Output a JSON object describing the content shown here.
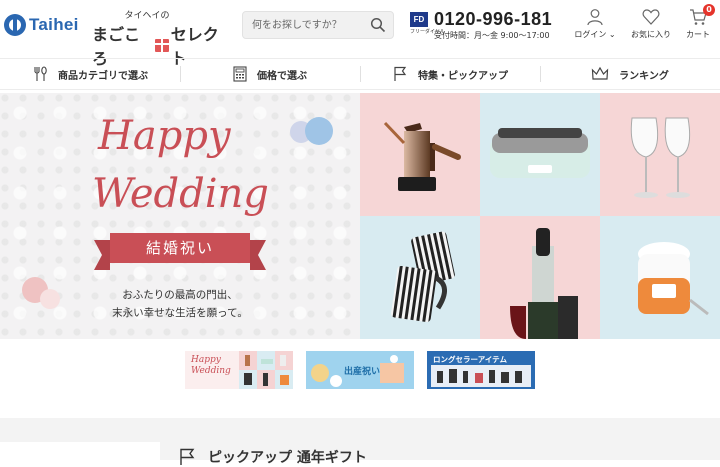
{
  "header": {
    "logo_text": "Taihei",
    "brand_kana": "タイヘイの",
    "brand_main_1": "まごころ",
    "brand_main_2": "セレクト",
    "search_placeholder": "何をお探しですか？",
    "phone_badge": "FD",
    "phone_badge_label": "フリーダイヤル",
    "phone_number": "0120-996-181",
    "phone_hours": "受付時間：月～金 9:00～17:00",
    "login_label": "ログイン",
    "favorites_label": "お気に入り",
    "cart_label": "カート",
    "cart_count": "0",
    "accent_color": "#2a67b1"
  },
  "nav": {
    "items": [
      {
        "label": "商品カテゴリで選ぶ",
        "icon": "fork-spoon-icon"
      },
      {
        "label": "価格で選ぶ",
        "icon": "calculator-icon"
      },
      {
        "label": "特集・ピックアップ",
        "icon": "flag-icon"
      },
      {
        "label": "ランキング",
        "icon": "crown-icon"
      }
    ]
  },
  "hero": {
    "title_1": "Happy",
    "title_2": "Wedding",
    "ribbon": "結婚祝い",
    "message_1": "おふたりの最高の門出、",
    "message_2": "末永い幸せな生活を願って。",
    "title_color": "#c94f56"
  },
  "banners": [
    {
      "label": "Happy Wedding"
    },
    {
      "label": "出産祝い"
    },
    {
      "label": "ロングセラーアイテム"
    }
  ],
  "section": {
    "title": "ピックアップ 通年ギフト"
  }
}
